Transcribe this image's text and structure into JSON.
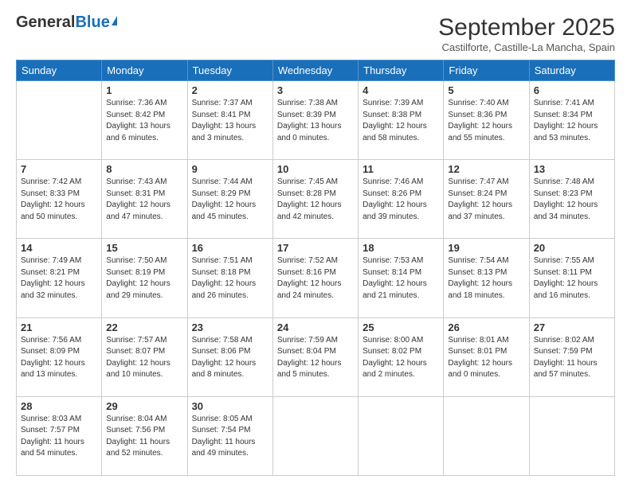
{
  "logo": {
    "general": "General",
    "blue": "Blue"
  },
  "header": {
    "month_year": "September 2025",
    "location": "Castilforte, Castille-La Mancha, Spain"
  },
  "days_of_week": [
    "Sunday",
    "Monday",
    "Tuesday",
    "Wednesday",
    "Thursday",
    "Friday",
    "Saturday"
  ],
  "weeks": [
    [
      {
        "day": "",
        "sunrise": "",
        "sunset": "",
        "daylight": ""
      },
      {
        "day": "1",
        "sunrise": "Sunrise: 7:36 AM",
        "sunset": "Sunset: 8:42 PM",
        "daylight": "Daylight: 13 hours and 6 minutes."
      },
      {
        "day": "2",
        "sunrise": "Sunrise: 7:37 AM",
        "sunset": "Sunset: 8:41 PM",
        "daylight": "Daylight: 13 hours and 3 minutes."
      },
      {
        "day": "3",
        "sunrise": "Sunrise: 7:38 AM",
        "sunset": "Sunset: 8:39 PM",
        "daylight": "Daylight: 13 hours and 0 minutes."
      },
      {
        "day": "4",
        "sunrise": "Sunrise: 7:39 AM",
        "sunset": "Sunset: 8:38 PM",
        "daylight": "Daylight: 12 hours and 58 minutes."
      },
      {
        "day": "5",
        "sunrise": "Sunrise: 7:40 AM",
        "sunset": "Sunset: 8:36 PM",
        "daylight": "Daylight: 12 hours and 55 minutes."
      },
      {
        "day": "6",
        "sunrise": "Sunrise: 7:41 AM",
        "sunset": "Sunset: 8:34 PM",
        "daylight": "Daylight: 12 hours and 53 minutes."
      }
    ],
    [
      {
        "day": "7",
        "sunrise": "Sunrise: 7:42 AM",
        "sunset": "Sunset: 8:33 PM",
        "daylight": "Daylight: 12 hours and 50 minutes."
      },
      {
        "day": "8",
        "sunrise": "Sunrise: 7:43 AM",
        "sunset": "Sunset: 8:31 PM",
        "daylight": "Daylight: 12 hours and 47 minutes."
      },
      {
        "day": "9",
        "sunrise": "Sunrise: 7:44 AM",
        "sunset": "Sunset: 8:29 PM",
        "daylight": "Daylight: 12 hours and 45 minutes."
      },
      {
        "day": "10",
        "sunrise": "Sunrise: 7:45 AM",
        "sunset": "Sunset: 8:28 PM",
        "daylight": "Daylight: 12 hours and 42 minutes."
      },
      {
        "day": "11",
        "sunrise": "Sunrise: 7:46 AM",
        "sunset": "Sunset: 8:26 PM",
        "daylight": "Daylight: 12 hours and 39 minutes."
      },
      {
        "day": "12",
        "sunrise": "Sunrise: 7:47 AM",
        "sunset": "Sunset: 8:24 PM",
        "daylight": "Daylight: 12 hours and 37 minutes."
      },
      {
        "day": "13",
        "sunrise": "Sunrise: 7:48 AM",
        "sunset": "Sunset: 8:23 PM",
        "daylight": "Daylight: 12 hours and 34 minutes."
      }
    ],
    [
      {
        "day": "14",
        "sunrise": "Sunrise: 7:49 AM",
        "sunset": "Sunset: 8:21 PM",
        "daylight": "Daylight: 12 hours and 32 minutes."
      },
      {
        "day": "15",
        "sunrise": "Sunrise: 7:50 AM",
        "sunset": "Sunset: 8:19 PM",
        "daylight": "Daylight: 12 hours and 29 minutes."
      },
      {
        "day": "16",
        "sunrise": "Sunrise: 7:51 AM",
        "sunset": "Sunset: 8:18 PM",
        "daylight": "Daylight: 12 hours and 26 minutes."
      },
      {
        "day": "17",
        "sunrise": "Sunrise: 7:52 AM",
        "sunset": "Sunset: 8:16 PM",
        "daylight": "Daylight: 12 hours and 24 minutes."
      },
      {
        "day": "18",
        "sunrise": "Sunrise: 7:53 AM",
        "sunset": "Sunset: 8:14 PM",
        "daylight": "Daylight: 12 hours and 21 minutes."
      },
      {
        "day": "19",
        "sunrise": "Sunrise: 7:54 AM",
        "sunset": "Sunset: 8:13 PM",
        "daylight": "Daylight: 12 hours and 18 minutes."
      },
      {
        "day": "20",
        "sunrise": "Sunrise: 7:55 AM",
        "sunset": "Sunset: 8:11 PM",
        "daylight": "Daylight: 12 hours and 16 minutes."
      }
    ],
    [
      {
        "day": "21",
        "sunrise": "Sunrise: 7:56 AM",
        "sunset": "Sunset: 8:09 PM",
        "daylight": "Daylight: 12 hours and 13 minutes."
      },
      {
        "day": "22",
        "sunrise": "Sunrise: 7:57 AM",
        "sunset": "Sunset: 8:07 PM",
        "daylight": "Daylight: 12 hours and 10 minutes."
      },
      {
        "day": "23",
        "sunrise": "Sunrise: 7:58 AM",
        "sunset": "Sunset: 8:06 PM",
        "daylight": "Daylight: 12 hours and 8 minutes."
      },
      {
        "day": "24",
        "sunrise": "Sunrise: 7:59 AM",
        "sunset": "Sunset: 8:04 PM",
        "daylight": "Daylight: 12 hours and 5 minutes."
      },
      {
        "day": "25",
        "sunrise": "Sunrise: 8:00 AM",
        "sunset": "Sunset: 8:02 PM",
        "daylight": "Daylight: 12 hours and 2 minutes."
      },
      {
        "day": "26",
        "sunrise": "Sunrise: 8:01 AM",
        "sunset": "Sunset: 8:01 PM",
        "daylight": "Daylight: 12 hours and 0 minutes."
      },
      {
        "day": "27",
        "sunrise": "Sunrise: 8:02 AM",
        "sunset": "Sunset: 7:59 PM",
        "daylight": "Daylight: 11 hours and 57 minutes."
      }
    ],
    [
      {
        "day": "28",
        "sunrise": "Sunrise: 8:03 AM",
        "sunset": "Sunset: 7:57 PM",
        "daylight": "Daylight: 11 hours and 54 minutes."
      },
      {
        "day": "29",
        "sunrise": "Sunrise: 8:04 AM",
        "sunset": "Sunset: 7:56 PM",
        "daylight": "Daylight: 11 hours and 52 minutes."
      },
      {
        "day": "30",
        "sunrise": "Sunrise: 8:05 AM",
        "sunset": "Sunset: 7:54 PM",
        "daylight": "Daylight: 11 hours and 49 minutes."
      },
      {
        "day": "",
        "sunrise": "",
        "sunset": "",
        "daylight": ""
      },
      {
        "day": "",
        "sunrise": "",
        "sunset": "",
        "daylight": ""
      },
      {
        "day": "",
        "sunrise": "",
        "sunset": "",
        "daylight": ""
      },
      {
        "day": "",
        "sunrise": "",
        "sunset": "",
        "daylight": ""
      }
    ]
  ]
}
